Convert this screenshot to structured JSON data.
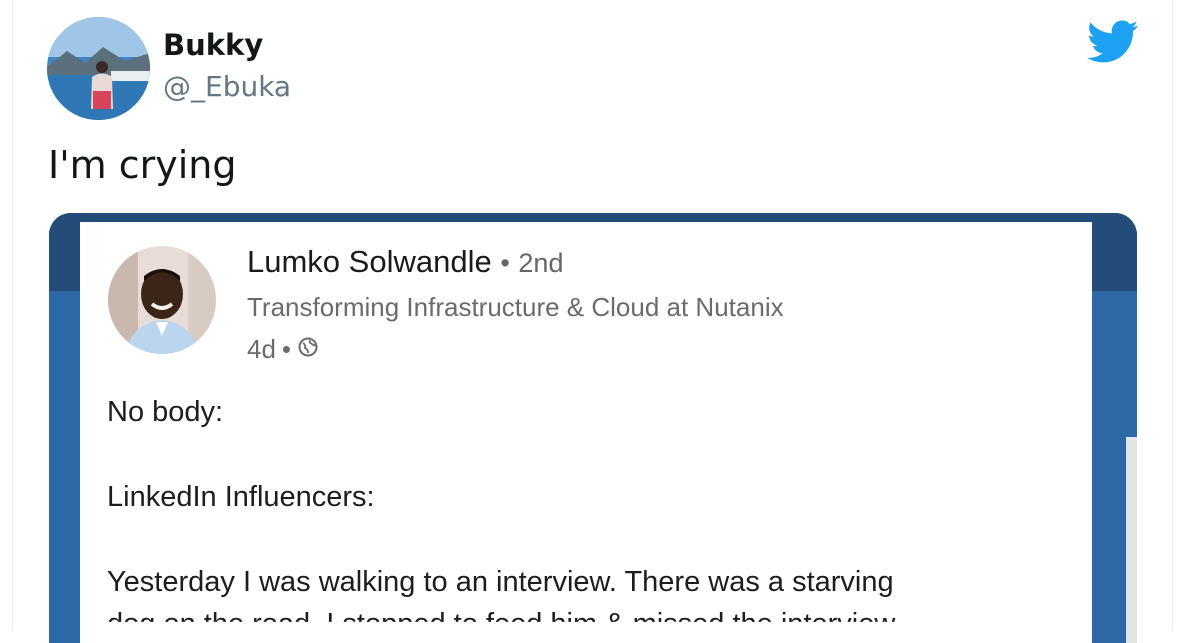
{
  "tweet": {
    "display_name": "Bukky",
    "handle": "@_Ebuka",
    "text": "I'm crying",
    "icons": {
      "avatar": "profile-photo",
      "logo": "twitter-bird-icon"
    },
    "colors": {
      "brand": "#1da1f2",
      "text": "#14171a",
      "muted": "#657786"
    }
  },
  "embedded_post": {
    "author": "Lumko Solwandle",
    "degree_separator": "•",
    "degree": "2nd",
    "headline": "Transforming Infrastructure & Cloud at Nutanix",
    "age": "4d",
    "age_separator": "•",
    "visibility_icon": "globe-icon",
    "lines": [
      "No body:",
      "LinkedIn Influencers:",
      "Yesterday I was walking to an interview. There was a starving",
      "dog on the road. I stopped to feed him & missed the interview."
    ],
    "colors": {
      "frame_dark": "#234c79",
      "frame_blue": "#2c69a6"
    }
  }
}
